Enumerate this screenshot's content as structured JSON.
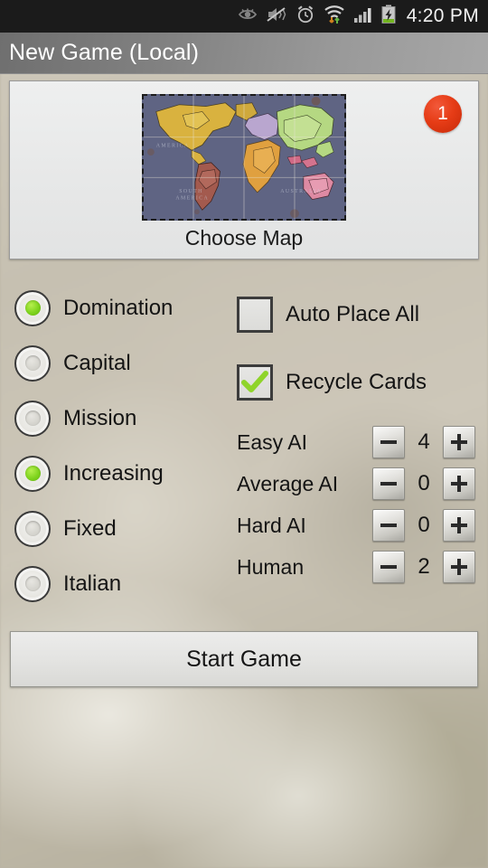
{
  "status_bar": {
    "icons": [
      "eye-icon",
      "mute-vibrate-icon",
      "alarm-icon",
      "wifi-transfer-icon",
      "signal-icon",
      "battery-charging-icon"
    ],
    "time": "4:20 PM"
  },
  "title_bar": {
    "title": "New Game (Local)"
  },
  "map_card": {
    "badge_count": "1",
    "choose_map_label": "Choose Map",
    "thumbnail_name": "world-map-thumbnail"
  },
  "game_modes": {
    "selected": "Domination",
    "items": [
      {
        "label": "Domination",
        "selected": true
      },
      {
        "label": "Capital",
        "selected": false
      },
      {
        "label": "Mission",
        "selected": false
      }
    ]
  },
  "card_modes": {
    "selected": "Increasing",
    "items": [
      {
        "label": "Increasing",
        "selected": true
      },
      {
        "label": "Fixed",
        "selected": false
      },
      {
        "label": "Italian",
        "selected": false
      }
    ]
  },
  "checkboxes": [
    {
      "label": "Auto Place All",
      "checked": false
    },
    {
      "label": "Recycle Cards",
      "checked": true
    }
  ],
  "player_counts": [
    {
      "label": "Easy AI",
      "value": "4"
    },
    {
      "label": "Average AI",
      "value": "0"
    },
    {
      "label": "Hard AI",
      "value": "0"
    },
    {
      "label": "Human",
      "value": "2"
    }
  ],
  "stepper": {
    "minus_label": "−",
    "plus_label": "+"
  },
  "start_button": {
    "label": "Start Game"
  },
  "colors": {
    "badge_red": "#e63c16",
    "selected_green": "#7fd41e",
    "check_green": "#8fd42a",
    "title_bar_gray": "#8a8a8a",
    "status_bar_black": "#1b1b1b"
  }
}
